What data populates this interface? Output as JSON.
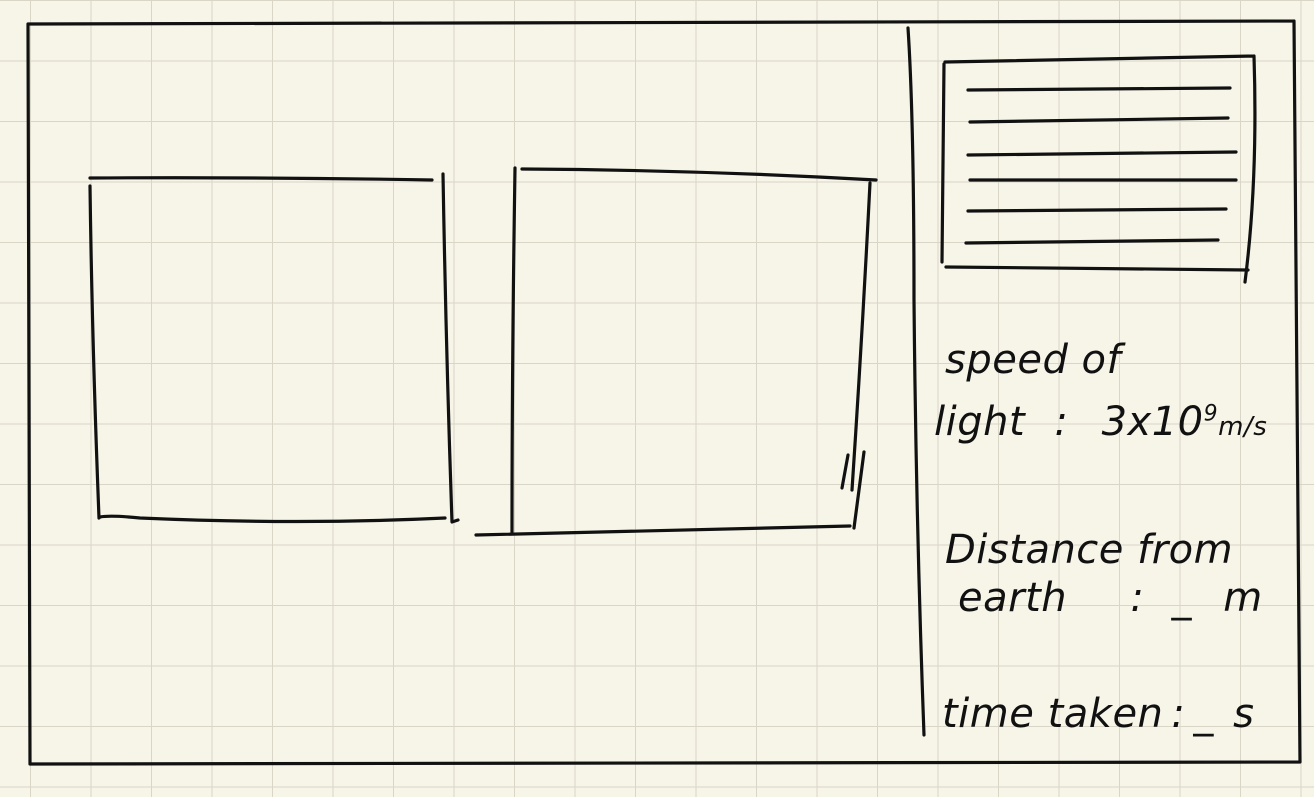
{
  "sidebar": {
    "speed": {
      "label_line1": "speed of",
      "label_line2": "light",
      "separator": ":",
      "value": "3x10",
      "exponent": "9",
      "unit": "m/s"
    },
    "distance": {
      "label_line1": "Distance from",
      "label_line2": "earth",
      "separator": ":",
      "blank": "_",
      "unit": "m"
    },
    "time": {
      "label": "time taken",
      "separator": ":",
      "blank": "_",
      "unit": "s"
    }
  }
}
